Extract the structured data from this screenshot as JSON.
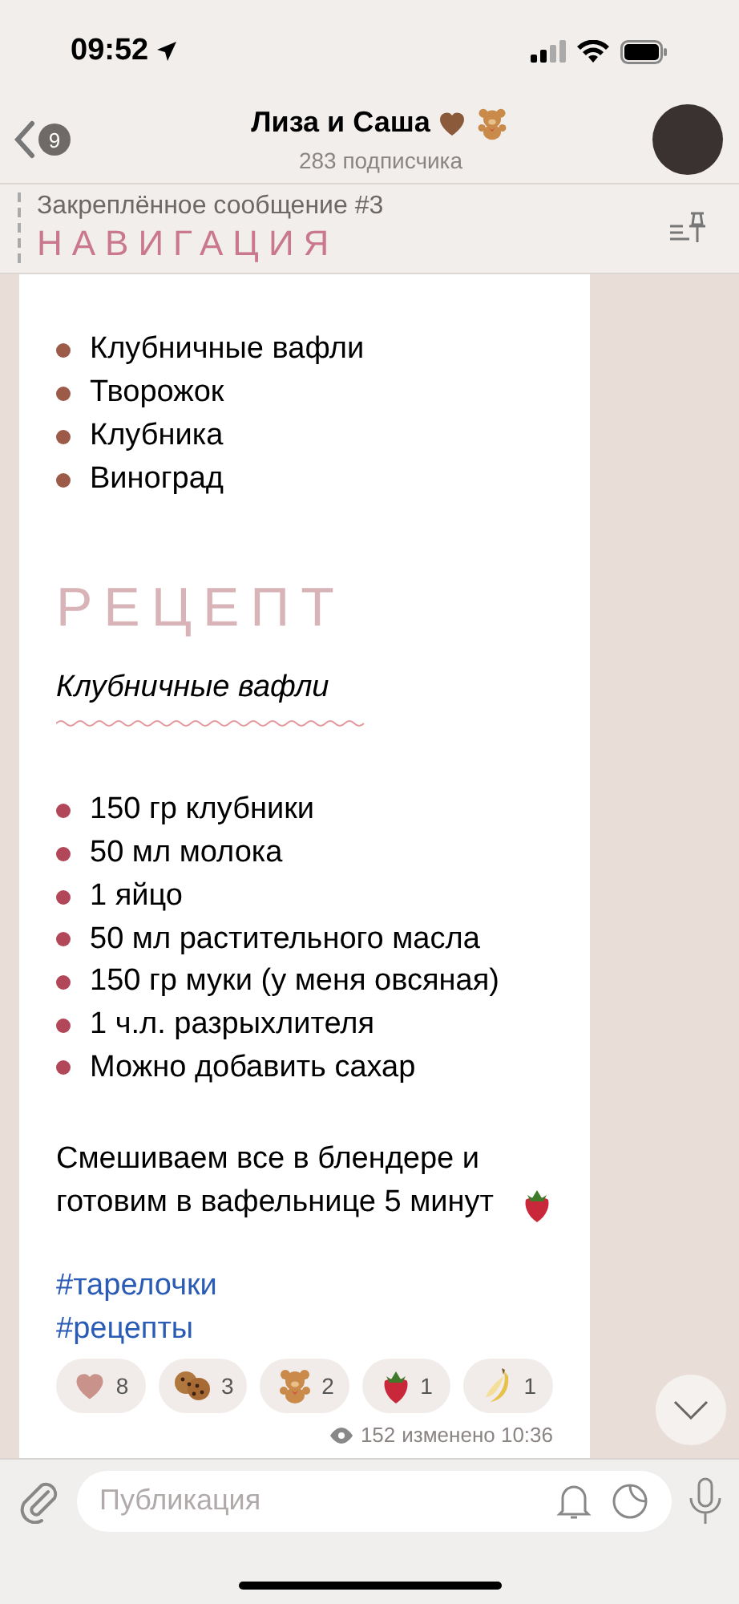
{
  "status_bar": {
    "time": "09:52"
  },
  "header": {
    "back_badge": "9",
    "title": "Лиза и Саша",
    "subtitle": "283 подписчика"
  },
  "pinned": {
    "label": "Закреплённое сообщение #3",
    "text": "НАВИГАЦИЯ"
  },
  "message": {
    "list_1": [
      "Клубничные вафли",
      "Творожок",
      "Клубника",
      "Виноград"
    ],
    "heading": "РЕЦЕПТ",
    "dish": "Клубничные вафли",
    "list_2": [
      "150 гр клубники",
      "50 мл молока",
      "1 яйцо",
      "50 мл растительного масла",
      "150 гр муки (у меня овсяная)",
      "1 ч.л. разрыхлителя",
      "Можно добавить сахар"
    ],
    "paragraph": "Смешиваем все в блендере и готовим в вафельнице 5 минут",
    "hashtags": [
      "#тарелочки",
      "#рецепты"
    ],
    "reactions": [
      {
        "kind": "heart",
        "count": "8"
      },
      {
        "kind": "cookie",
        "count": "3"
      },
      {
        "kind": "bear",
        "count": "2"
      },
      {
        "kind": "strawberry",
        "count": "1"
      },
      {
        "kind": "banana",
        "count": "1"
      }
    ],
    "views": "152",
    "edited": "изменено 10:36"
  },
  "composer": {
    "placeholder": "Публикация"
  }
}
